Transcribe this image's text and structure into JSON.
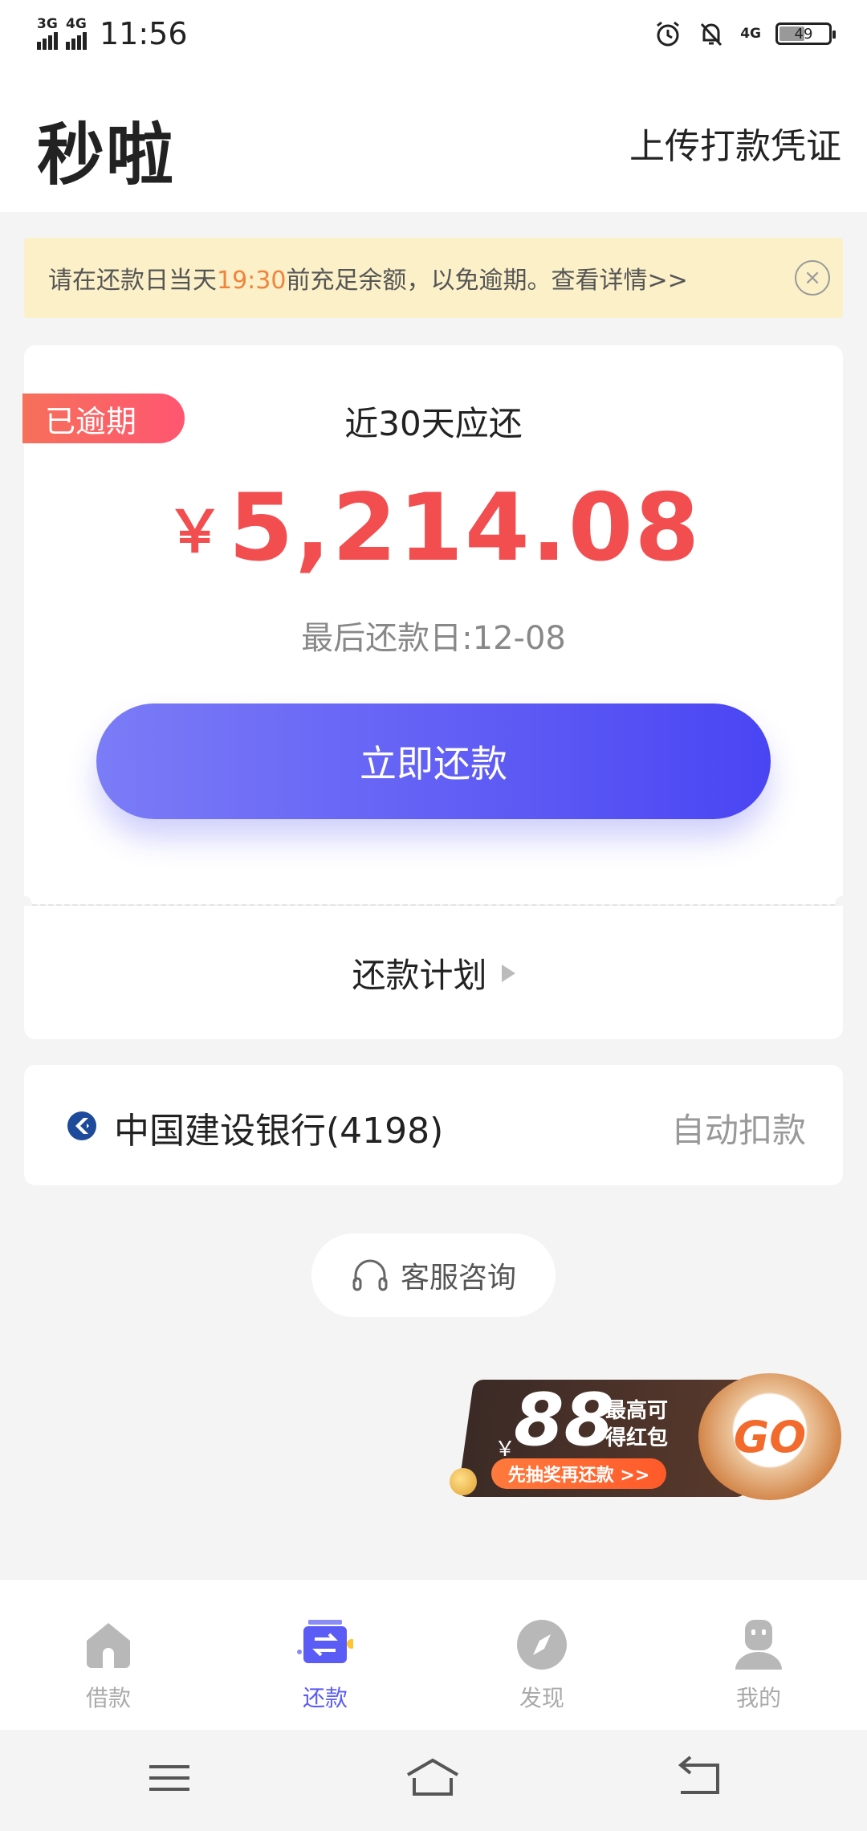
{
  "status_bar": {
    "net1": "3G",
    "net2": "4G",
    "time": "11:56",
    "net3": "4G",
    "battery": "49"
  },
  "header": {
    "title": "秒啦",
    "upload_link": "上传打款凭证"
  },
  "notice": {
    "text_before": "请在还款日当天",
    "text_time": "19:30",
    "text_after": "前充足余额，以免逾期。查看详情>>"
  },
  "repayment": {
    "status_badge": "已逾期",
    "due_label": "近30天应还",
    "currency": "￥",
    "amount": "5,214.08",
    "due_date": "最后还款日:12-08",
    "pay_button": "立即还款"
  },
  "plan": {
    "label": "还款计划"
  },
  "bank": {
    "name": "中国建设银行(4198)",
    "mode": "自动扣款"
  },
  "customer_service": {
    "label": "客服咨询"
  },
  "promo": {
    "currency": "￥",
    "amount": "88",
    "line1": "最高可",
    "line2": "得红包",
    "pill": "先抽奖再还款 >>",
    "go": "GO"
  },
  "tabs": [
    {
      "label": "借款",
      "icon": "home-icon"
    },
    {
      "label": "还款",
      "icon": "repay-icon"
    },
    {
      "label": "发现",
      "icon": "compass-icon"
    },
    {
      "label": "我的",
      "icon": "profile-icon"
    }
  ],
  "active_tab": "还款",
  "colors": {
    "accent": "#5b5cf5",
    "amount": "#f24e50",
    "notice_bg": "#fbf0c8",
    "highlight": "#f2823c"
  }
}
